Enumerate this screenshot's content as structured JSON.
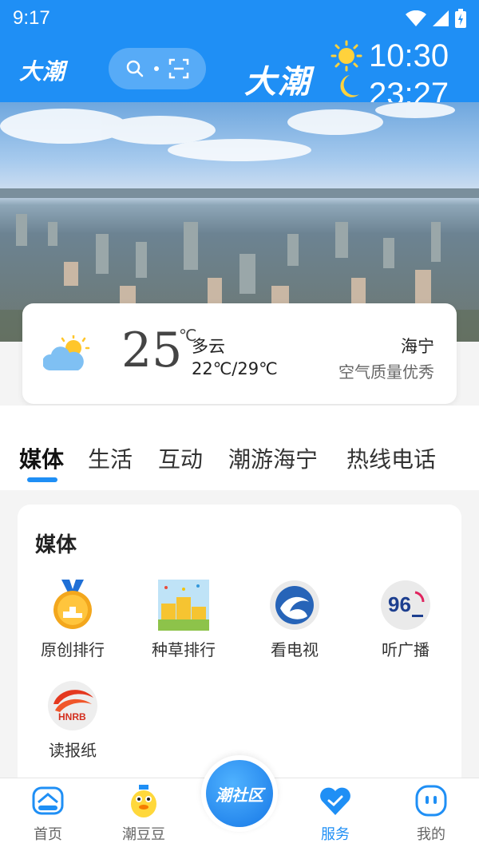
{
  "status_bar": {
    "time": "9:17"
  },
  "header": {
    "brand_left": "大潮",
    "brand_big": "大潮",
    "time_top": "10:30",
    "time_bottom": "23:27"
  },
  "weather": {
    "temp": "25",
    "temp_unit": "℃",
    "condition": "多云",
    "range": "22℃/29℃",
    "city": "海宁",
    "air_quality": "空气质量优秀"
  },
  "tabs": [
    {
      "label": "媒体",
      "active": true
    },
    {
      "label": "生活"
    },
    {
      "label": "互动"
    },
    {
      "label": "潮游海宁"
    },
    {
      "label": "热线电话"
    }
  ],
  "media_section": {
    "title": "媒体",
    "items": [
      {
        "label": "原创排行",
        "icon": "medal-ranking-icon"
      },
      {
        "label": "种草排行",
        "icon": "podium-ranking-icon"
      },
      {
        "label": "看电视",
        "icon": "tv-logo-icon"
      },
      {
        "label": "听广播",
        "icon": "radio-96-icon"
      },
      {
        "label": "读报纸",
        "icon": "hnrb-newspaper-icon"
      }
    ]
  },
  "bottom_nav": {
    "items": [
      {
        "label": "首页",
        "icon": "home-icon"
      },
      {
        "label": "潮豆豆",
        "icon": "mascot-icon"
      },
      {
        "label": "服务",
        "icon": "heart-icon",
        "active": true
      },
      {
        "label": "我的",
        "icon": "profile-icon"
      }
    ],
    "center_label": "潮社区"
  },
  "colors": {
    "accent": "#1f8ff5",
    "header_bg": "#1f8ff5"
  }
}
